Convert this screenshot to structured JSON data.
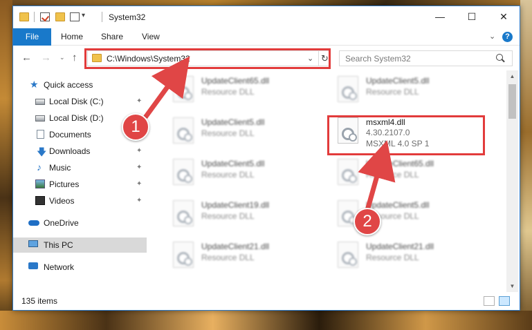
{
  "window": {
    "title": "System32",
    "controls": {
      "minimize": "—",
      "maximize": "☐",
      "close": "✕"
    }
  },
  "ribbon": {
    "tabs": [
      "File",
      "Home",
      "Share",
      "View"
    ],
    "expand_chevron": "⌄",
    "help": "?"
  },
  "nav": {
    "back": "←",
    "forward": "→",
    "recent": "⌄",
    "up": "↑",
    "address": "C:\\Windows\\System32",
    "address_chevron": "⌄",
    "refresh": "↻",
    "search_placeholder": "Search System32"
  },
  "sidebar": {
    "items": [
      {
        "label": "Quick access",
        "icon": "star-icon"
      },
      {
        "label": "Local Disk (C:)",
        "icon": "drive-icon",
        "pinned": true
      },
      {
        "label": "Local Disk (D:)",
        "icon": "drive-icon",
        "pinned": false
      },
      {
        "label": "Documents",
        "icon": "documents-icon",
        "pinned": true
      },
      {
        "label": "Downloads",
        "icon": "downloads-icon",
        "pinned": true
      },
      {
        "label": "Music",
        "icon": "music-icon",
        "pinned": true
      },
      {
        "label": "Pictures",
        "icon": "pictures-icon",
        "pinned": true
      },
      {
        "label": "Videos",
        "icon": "videos-icon",
        "pinned": true
      },
      {
        "label": "OneDrive",
        "icon": "onedrive-icon"
      },
      {
        "label": "This PC",
        "icon": "pc-icon",
        "selected": true
      },
      {
        "label": "Network",
        "icon": "network-icon"
      }
    ],
    "pin_glyph": "📌"
  },
  "files": [
    {
      "name": "UpdateClient65.dll",
      "desc": "Resource DLL"
    },
    {
      "name": "UpdateClient5.dll",
      "desc": "Resource DLL"
    },
    {
      "name": "UpdateClient5.dll",
      "desc": "Resource DLL"
    },
    {
      "name": "msxml4.dll",
      "version": "4.30.2107.0",
      "desc": "MSXML 4.0 SP 1"
    },
    {
      "name": "UpdateClient5.dll",
      "desc": "Resource DLL"
    },
    {
      "name": "UpdateClient65.dll",
      "desc": "Resource DLL"
    },
    {
      "name": "UpdateClient19.dll",
      "desc": "Resource DLL"
    },
    {
      "name": "UpdateClient5.dll",
      "desc": "Resource DLL"
    },
    {
      "name": "UpdateClient21.dll",
      "desc": "Resource DLL"
    },
    {
      "name": "UpdateClient21.dll",
      "desc": "Resource DLL"
    }
  ],
  "status": {
    "item_count": "135 items"
  },
  "annotations": {
    "badge1": "1",
    "badge2": "2",
    "color": "#e23b3b"
  }
}
